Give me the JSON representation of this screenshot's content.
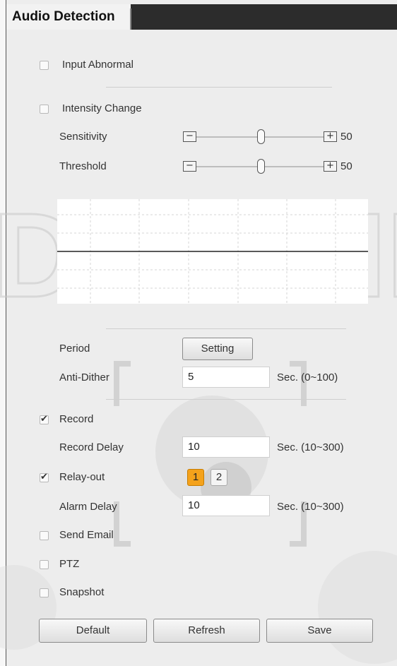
{
  "title": "Audio Detection",
  "input_abnormal": {
    "label": "Input Abnormal",
    "checked": false
  },
  "intensity_change": {
    "label": "Intensity Change",
    "checked": false
  },
  "sensitivity": {
    "label": "Sensitivity",
    "minus": "−",
    "plus": "+",
    "value": "50"
  },
  "threshold": {
    "label": "Threshold",
    "minus": "−",
    "plus": "+",
    "value": "50"
  },
  "period": {
    "label": "Period",
    "button": "Setting"
  },
  "anti_dither": {
    "label": "Anti-Dither",
    "value": "5",
    "range": "Sec. (0~100)"
  },
  "record": {
    "label": "Record",
    "checked": true
  },
  "record_delay": {
    "label": "Record Delay",
    "value": "10",
    "range": "Sec. (10~300)"
  },
  "relay_out": {
    "label": "Relay-out",
    "checked": true,
    "buttons": [
      "1",
      "2"
    ],
    "active": "1"
  },
  "alarm_delay": {
    "label": "Alarm Delay",
    "value": "10",
    "range": "Sec. (10~300)"
  },
  "send_email": {
    "label": "Send Email",
    "checked": false
  },
  "ptz": {
    "label": "PTZ",
    "checked": false
  },
  "snapshot": {
    "label": "Snapshot",
    "checked": false
  },
  "buttons": {
    "default": "Default",
    "refresh": "Refresh",
    "save": "Save"
  },
  "watermark": {
    "text": "DISTRIB"
  },
  "colors": {
    "accent": "#f4a21b",
    "title_bar": "#2c2c2c",
    "background": "#ededed"
  }
}
